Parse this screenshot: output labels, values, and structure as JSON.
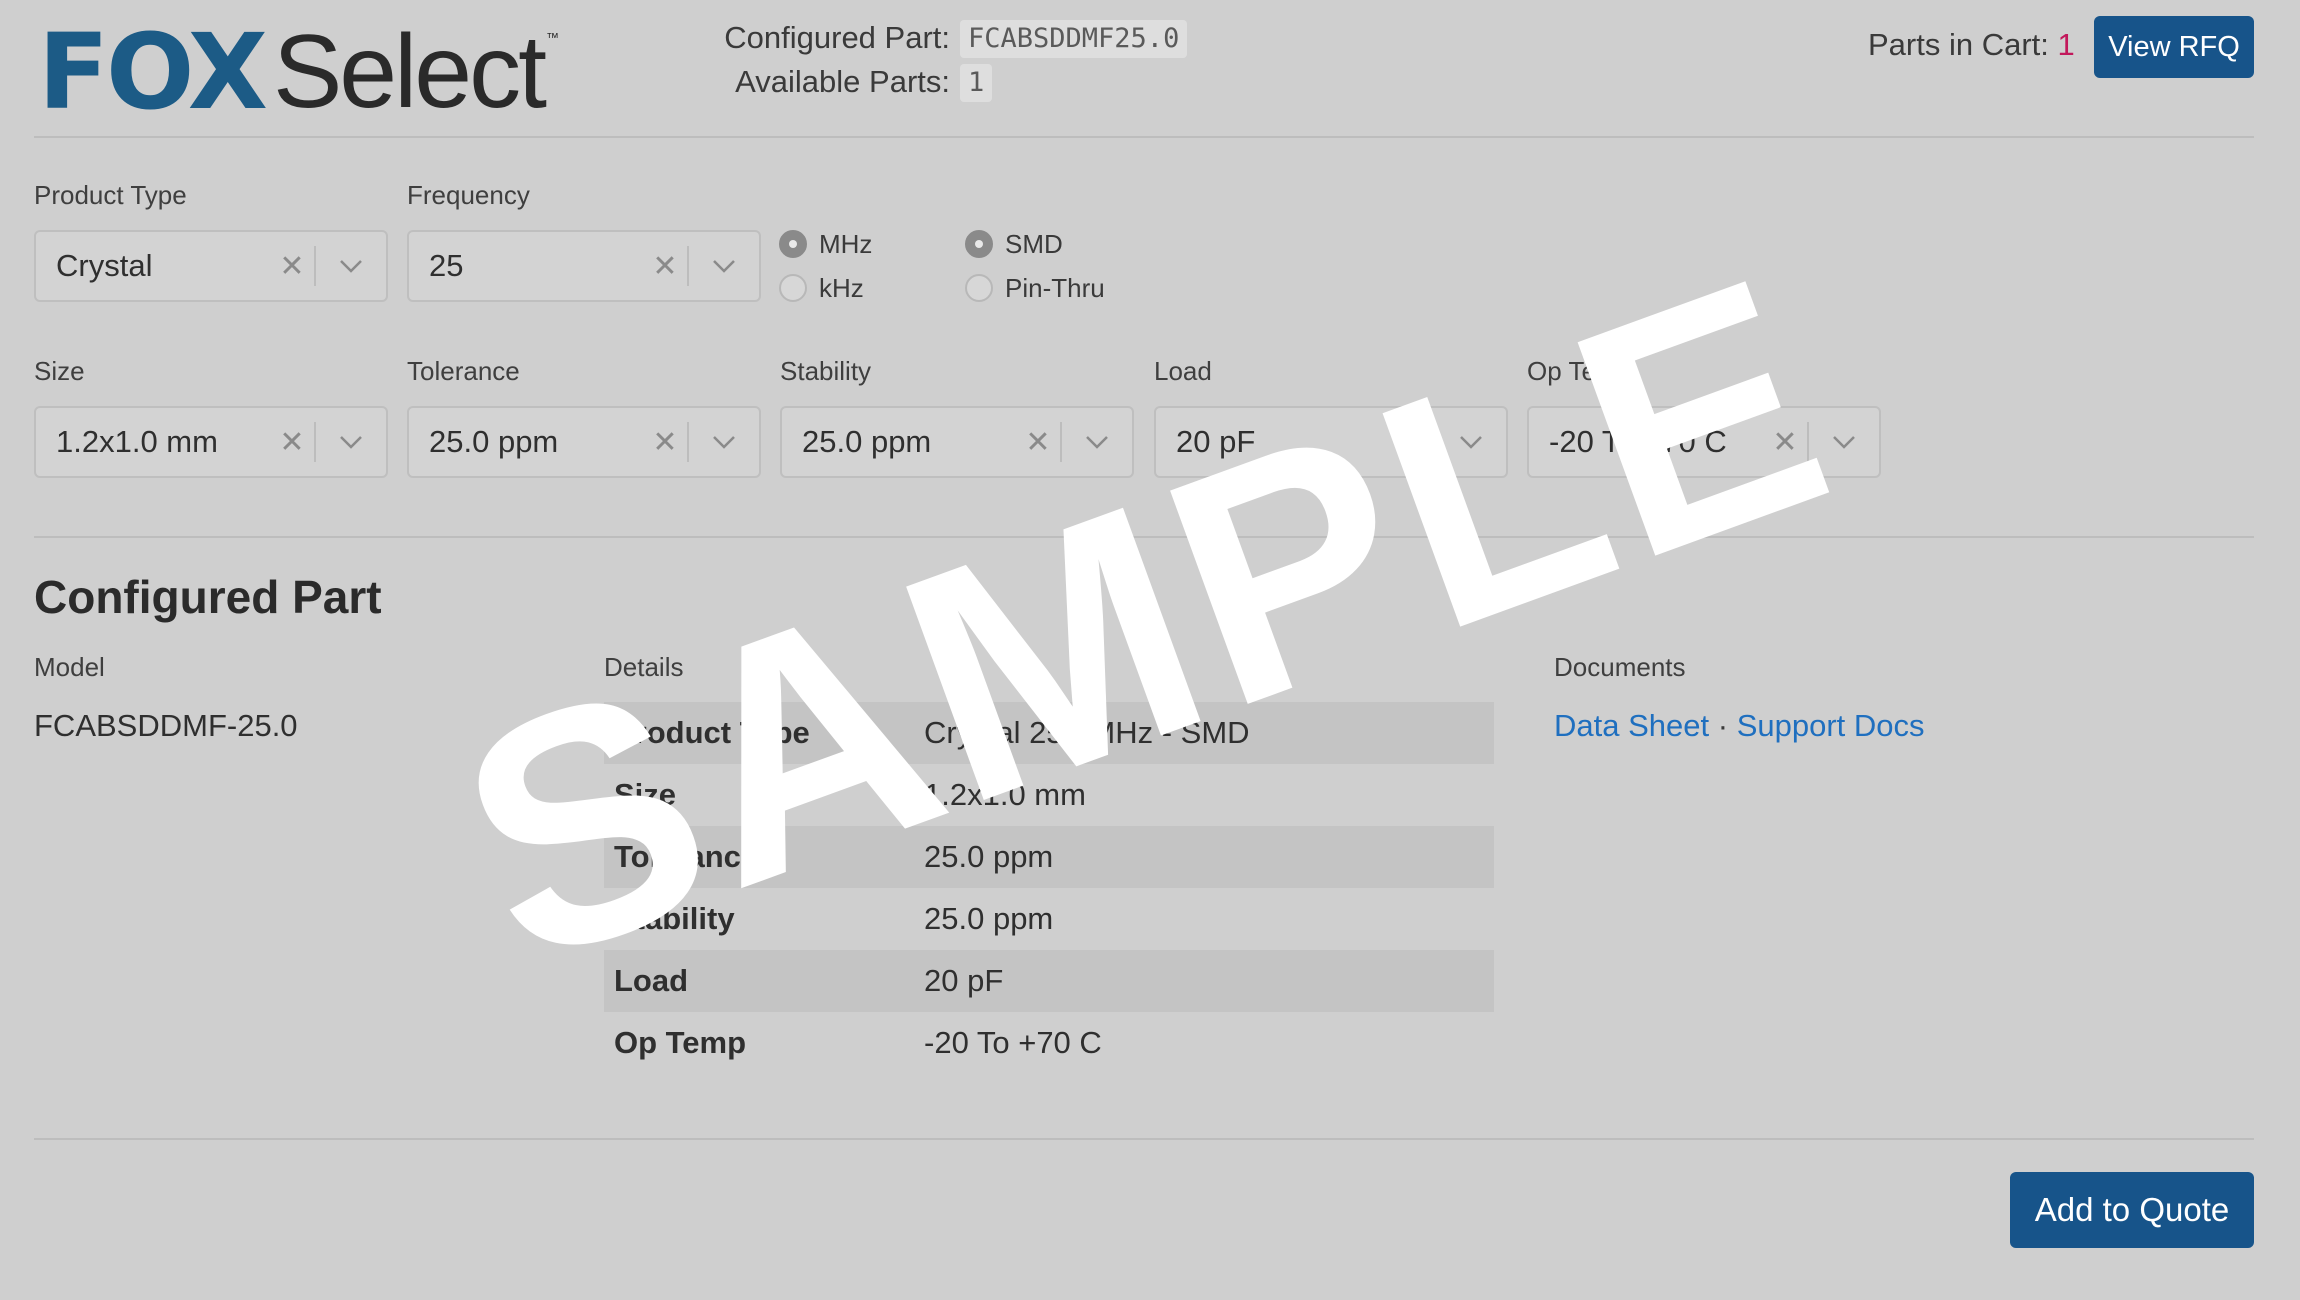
{
  "brand": {
    "fox": "FOX",
    "select": "Select",
    "tm": "™"
  },
  "header": {
    "configured_label": "Configured Part:",
    "configured_value": "FCABSDDMF25.0",
    "available_label": "Available Parts:",
    "available_value": "1",
    "cart_label": "Parts in Cart:",
    "cart_count": "1",
    "view_rfq": "View RFQ"
  },
  "filters": {
    "product_type": {
      "label": "Product Type",
      "value": "Crystal"
    },
    "frequency": {
      "label": "Frequency",
      "value": "25"
    },
    "freq_units": [
      {
        "label": "MHz",
        "selected": true
      },
      {
        "label": "kHz",
        "selected": false
      }
    ],
    "mount": [
      {
        "label": "SMD",
        "selected": true
      },
      {
        "label": "Pin-Thru",
        "selected": false
      }
    ],
    "size": {
      "label": "Size",
      "value": "1.2x1.0 mm"
    },
    "tolerance": {
      "label": "Tolerance",
      "value": "25.0 ppm"
    },
    "stability": {
      "label": "Stability",
      "value": "25.0 ppm"
    },
    "load": {
      "label": "Load",
      "value": "20 pF"
    },
    "op_temp": {
      "label": "Op Temp",
      "value": "-20 To +70 C"
    }
  },
  "configured": {
    "title": "Configured Part",
    "model_label": "Model",
    "model_value": "FCABSDDMF-25.0",
    "details_label": "Details",
    "details": [
      {
        "key": "Product Type",
        "value": "Crystal 25.0MHz - SMD"
      },
      {
        "key": "Size",
        "value": "1.2x1.0 mm"
      },
      {
        "key": "Tolerance",
        "value": "25.0 ppm"
      },
      {
        "key": "Stability",
        "value": "25.0 ppm"
      },
      {
        "key": "Load",
        "value": "20 pF"
      },
      {
        "key": "Op Temp",
        "value": "-20 To +70 C"
      }
    ],
    "documents_label": "Documents",
    "data_sheet": "Data Sheet",
    "doc_sep": "·",
    "support_docs": "Support Docs"
  },
  "footer": {
    "add_to_quote": "Add to Quote"
  },
  "watermark": "SAMPLE",
  "colors": {
    "brand_blue": "#1c5b86",
    "button_blue": "#17548a",
    "link_blue": "#1f6fbf",
    "cart_count": "#c2185b",
    "background": "#cfcfcf"
  },
  "icons": {
    "clear": "close-icon",
    "dropdown": "chevron-down-icon"
  }
}
